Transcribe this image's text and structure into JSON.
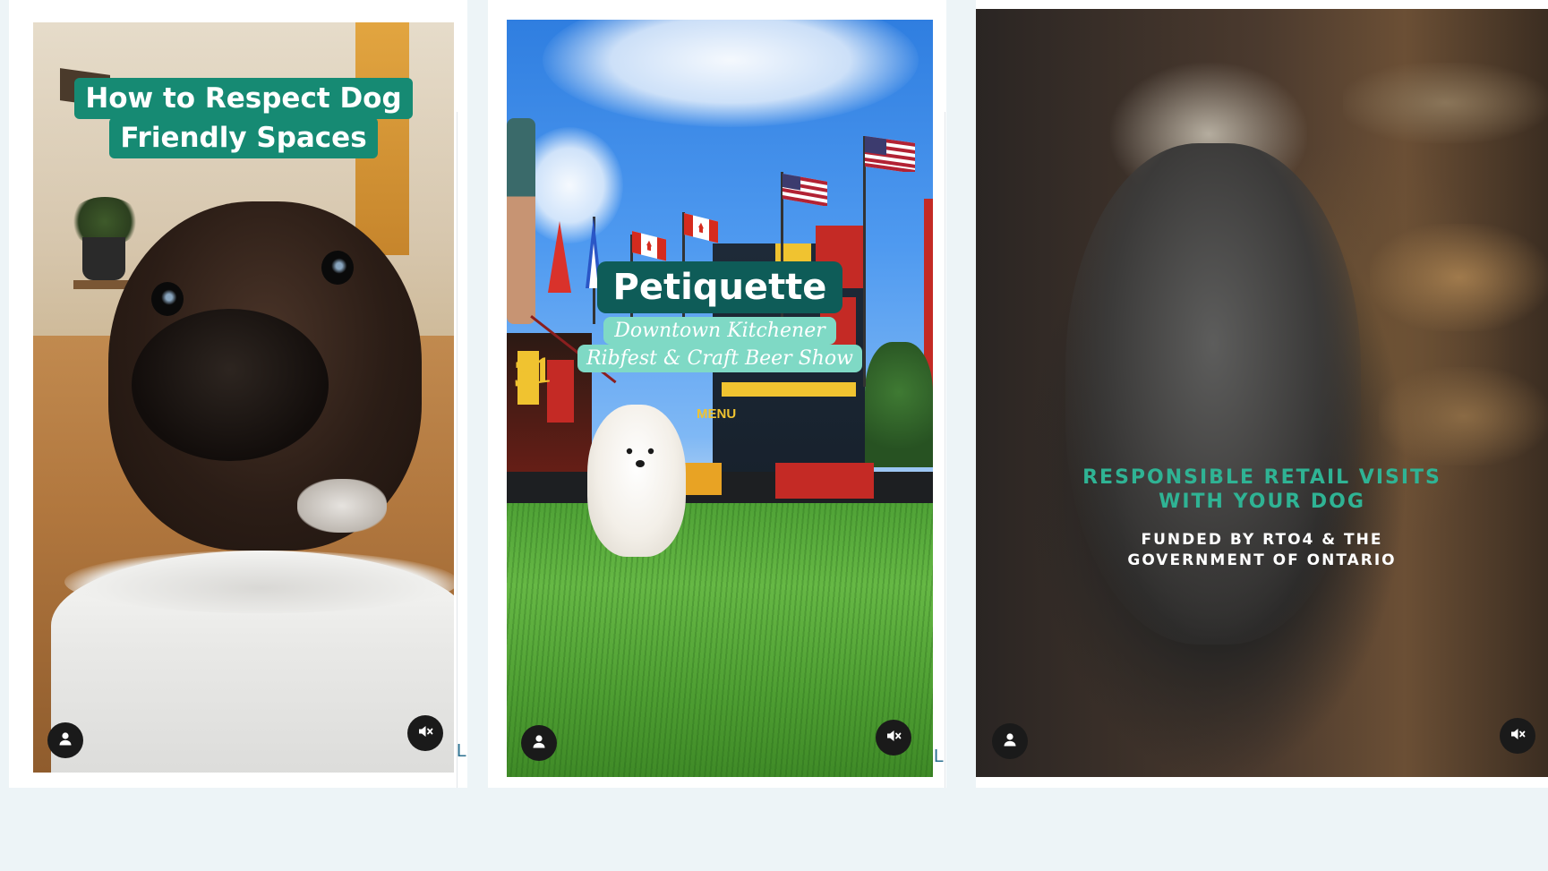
{
  "cards": [
    {
      "title_line1": "How to Respect Dog",
      "title_line2": "Friendly Spaces",
      "stub_text": "L"
    },
    {
      "title": "Petiquette",
      "subtitle_line1": "Downtown Kitchener",
      "subtitle_line2": "Ribfest & Craft Beer Show",
      "stub_text": "L"
    },
    {
      "headline_line1": "RESPONSIBLE RETAIL VISITS",
      "headline_line2": "WITH YOUR DOG",
      "credit_line1": "FUNDED BY RTO4 & THE",
      "credit_line2": "GOVERNMENT OF ONTARIO"
    }
  ],
  "background_signage": {
    "menu_sign": "MENU",
    "number_sign": "31"
  },
  "icons": {
    "profile": "user-icon",
    "mute": "muted-speaker-icon"
  },
  "colors": {
    "pill_teal": "#168a73",
    "pill_dark_teal": "#0e5c58",
    "mint_text": "#2fb394",
    "page_bg": "#edf4f7"
  }
}
